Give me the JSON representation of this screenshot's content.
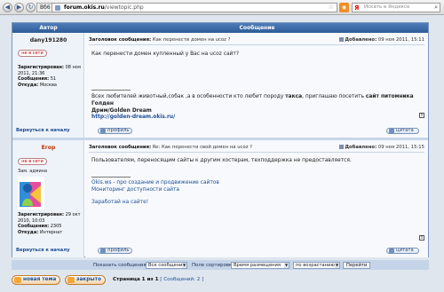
{
  "browser": {
    "tab_label": "Вб6",
    "url_host": "forum.okis.ru",
    "url_path": "/viewtopic.php",
    "search_placeholder": "Искать в Яндексе"
  },
  "forum": {
    "headers": {
      "author": "Автор",
      "message": "Сообщение"
    },
    "posts": [
      {
        "author": "dany191280",
        "status_label": "не в сети",
        "meta": {
          "registered_label": "Зарегистрирован:",
          "registered_value": "08 ноя 2011, 21:36",
          "messages_label": "Сообщения:",
          "messages_value": "51",
          "from_label": "Откуда:",
          "from_value": "Москва"
        },
        "subject_label": "Заголовок сообщения:",
        "subject": "Как перенести домен на ucoz ?",
        "date_label": "Добавлено:",
        "date": "09 ноя 2011, 15:11",
        "body": {
          "line1": "Как перенести домен купленный у Вас на ucoz сайт?",
          "line2_part1": "Всех любителей животный,собак ,а в особенности кто любит породу",
          "line2_bold1": "такса",
          "line2_part2": ", приглашаю посетить",
          "line2_bold2": "сайт питомника Голден",
          "line3": "Дрим/Golden Dream",
          "line4": "http://golden-dream.okis.ru/"
        },
        "back_to_top": "Вернуться к началу",
        "profile_btn": "профиль",
        "quote_btn": "цитата"
      },
      {
        "author": "Егор",
        "status_label": "не в сети",
        "rank": "Зам. админа",
        "meta": {
          "registered_label": "Зарегистрирован:",
          "registered_value": "29 окт 2010, 10:03",
          "messages_label": "Сообщения:",
          "messages_value": "2305",
          "from_label": "Откуда:",
          "from_value": "Интернат"
        },
        "subject_label": "Заголовок сообщения:",
        "subject": "Re: Как перенести свой домен на ucoz ?",
        "date_label": "Добавлено:",
        "date": "09 ноя 2011, 15:15",
        "body": {
          "line1": "Пользователям, переносящим сайты к другим хостерам, техподдержка не предоставляется.",
          "sig1": "Okis.ws - про создание и продвижение сайтов",
          "sig2": "Мониторинг доступности сайта",
          "sig3": "Заработай на сайте!"
        },
        "back_to_top": "Вернуться к началу",
        "profile_btn": "профиль",
        "quote_btn": "цитата"
      }
    ]
  },
  "sortbar": {
    "show_label": "Показать сообщения за:",
    "show_value": "Все сообщения",
    "sort_label": "Поле сортировки",
    "sort_value": "Время размещения",
    "order_value": "по возрастанию",
    "go_label": "Перейти"
  },
  "footer": {
    "new_topic": "новая тема",
    "locked": "закрыто",
    "page_label": "Страница",
    "page_of": "1 из 1",
    "messages_count": "[ Сообщений: 2 ]"
  },
  "colors": {
    "header_blue": "#2d5b96",
    "link_blue": "#1e4f96",
    "author_red": "#c03000"
  }
}
